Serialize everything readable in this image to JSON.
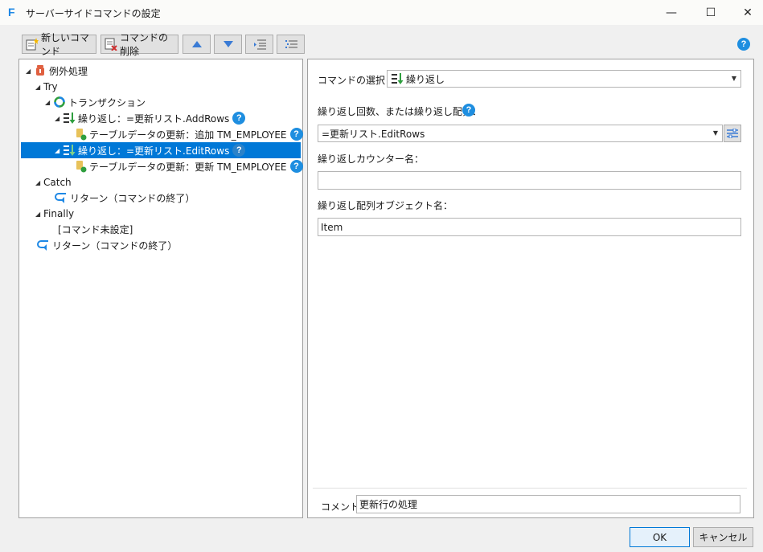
{
  "window": {
    "title": "サーバーサイドコマンドの設定",
    "icon_letter": "F",
    "minimize": "—",
    "maximize": "☐",
    "close": "✕"
  },
  "toolbar": {
    "new_command": "新しいコマンド",
    "delete_command": "コマンドの削除",
    "help": "?"
  },
  "tree": {
    "items": [
      {
        "label": "例外処理"
      },
      {
        "label": "Try"
      },
      {
        "label": "トランザクション"
      },
      {
        "label": "繰り返し：=更新リスト.AddRows"
      },
      {
        "label": "テーブルデータの更新：追加 TM_EMPLOYEE"
      },
      {
        "label": "繰り返し：=更新リスト.EditRows"
      },
      {
        "label": "テーブルデータの更新：更新 TM_EMPLOYEE"
      },
      {
        "label": "Catch"
      },
      {
        "label": "リターン（コマンドの終了）"
      },
      {
        "label": "Finally"
      },
      {
        "label": "[コマンド未設定]"
      },
      {
        "label": "リターン（コマンドの終了）"
      }
    ],
    "help": "?"
  },
  "detail": {
    "command_select_label": "コマンドの選択：",
    "command_select_value": "繰り返し",
    "repeat_label": "繰り返し回数、または繰り返し配列：",
    "repeat_value": "=更新リスト.EditRows",
    "counter_label": "繰り返しカウンター名：",
    "counter_value": "",
    "object_label": "繰り返し配列オブジェクト名：",
    "object_value": "Item",
    "comment_label": "コメント",
    "comment_value": "更新行の処理",
    "help": "?"
  },
  "buttons": {
    "ok": "OK",
    "cancel": "キャンセル"
  },
  "colors": {
    "accent": "#0078d7",
    "help": "#1e8ee0",
    "repeat_icon_green": "#2e9e3e",
    "exception_icon": "#e06040"
  }
}
